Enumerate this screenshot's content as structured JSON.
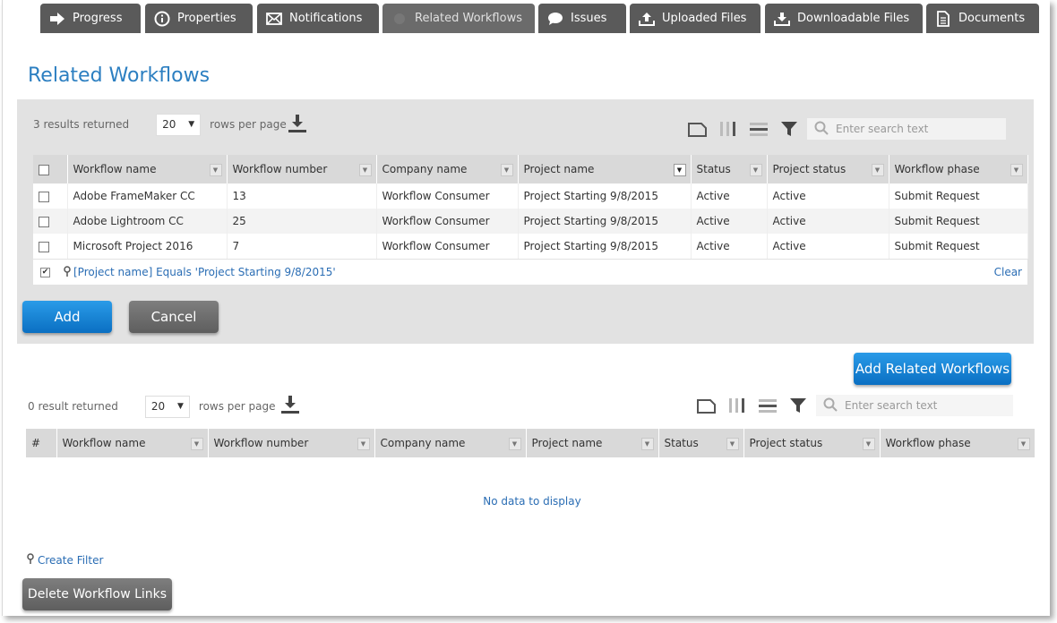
{
  "tabs": [
    {
      "label": "Progress",
      "icon": "arrow-right-icon"
    },
    {
      "label": "Properties",
      "icon": "info-icon"
    },
    {
      "label": "Notifications",
      "icon": "envelope-icon"
    },
    {
      "label": "Related Workflows",
      "icon": "workflow-icon"
    },
    {
      "label": "Issues",
      "icon": "speech-bubble-icon"
    },
    {
      "label": "Uploaded Files",
      "icon": "upload-icon"
    },
    {
      "label": "Downloadable Files",
      "icon": "download-icon"
    },
    {
      "label": "Documents",
      "icon": "document-icon"
    }
  ],
  "page_title": "Related Workflows",
  "top_grid": {
    "results_text": "3 results returned",
    "rows_per_page_value": "20",
    "rows_per_page_label": "rows per page",
    "search_placeholder": "Enter search text",
    "columns": [
      "Workflow name",
      "Workflow number",
      "Company name",
      "Project name",
      "Status",
      "Project status",
      "Workflow phase"
    ],
    "rows": [
      [
        "Adobe FrameMaker CC",
        "13",
        "Workflow Consumer",
        "Project Starting 9/8/2015",
        "Active",
        "Active",
        "Submit Request"
      ],
      [
        "Adobe Lightroom CC",
        "25",
        "Workflow Consumer",
        "Project Starting 9/8/2015",
        "Active",
        "Active",
        "Submit Request"
      ],
      [
        "Microsoft Project 2016",
        "7",
        "Workflow Consumer",
        "Project Starting 9/8/2015",
        "Active",
        "Active",
        "Submit Request"
      ]
    ],
    "active_filter": "[Project name] Equals 'Project Starting 9/8/2015'",
    "clear_label": "Clear"
  },
  "buttons": {
    "add": "Add",
    "cancel": "Cancel",
    "add_related": "Add Related Workflows",
    "delete_links": "Delete Workflow Links"
  },
  "bottom_grid": {
    "results_text": "0 result returned",
    "rows_per_page_value": "20",
    "rows_per_page_label": "rows per page",
    "search_placeholder": "Enter search text",
    "columns": [
      "#",
      "Workflow name",
      "Workflow number",
      "Company name",
      "Project name",
      "Status",
      "Project status",
      "Workflow phase"
    ],
    "no_data": "No data to display",
    "create_filter": "Create Filter"
  },
  "colors": {
    "accent": "#2c7fc1",
    "tab_bg": "#5a5a5a",
    "button_blue": "#1a86d6",
    "button_gray": "#6e6e6e",
    "link": "#2a6db4"
  }
}
